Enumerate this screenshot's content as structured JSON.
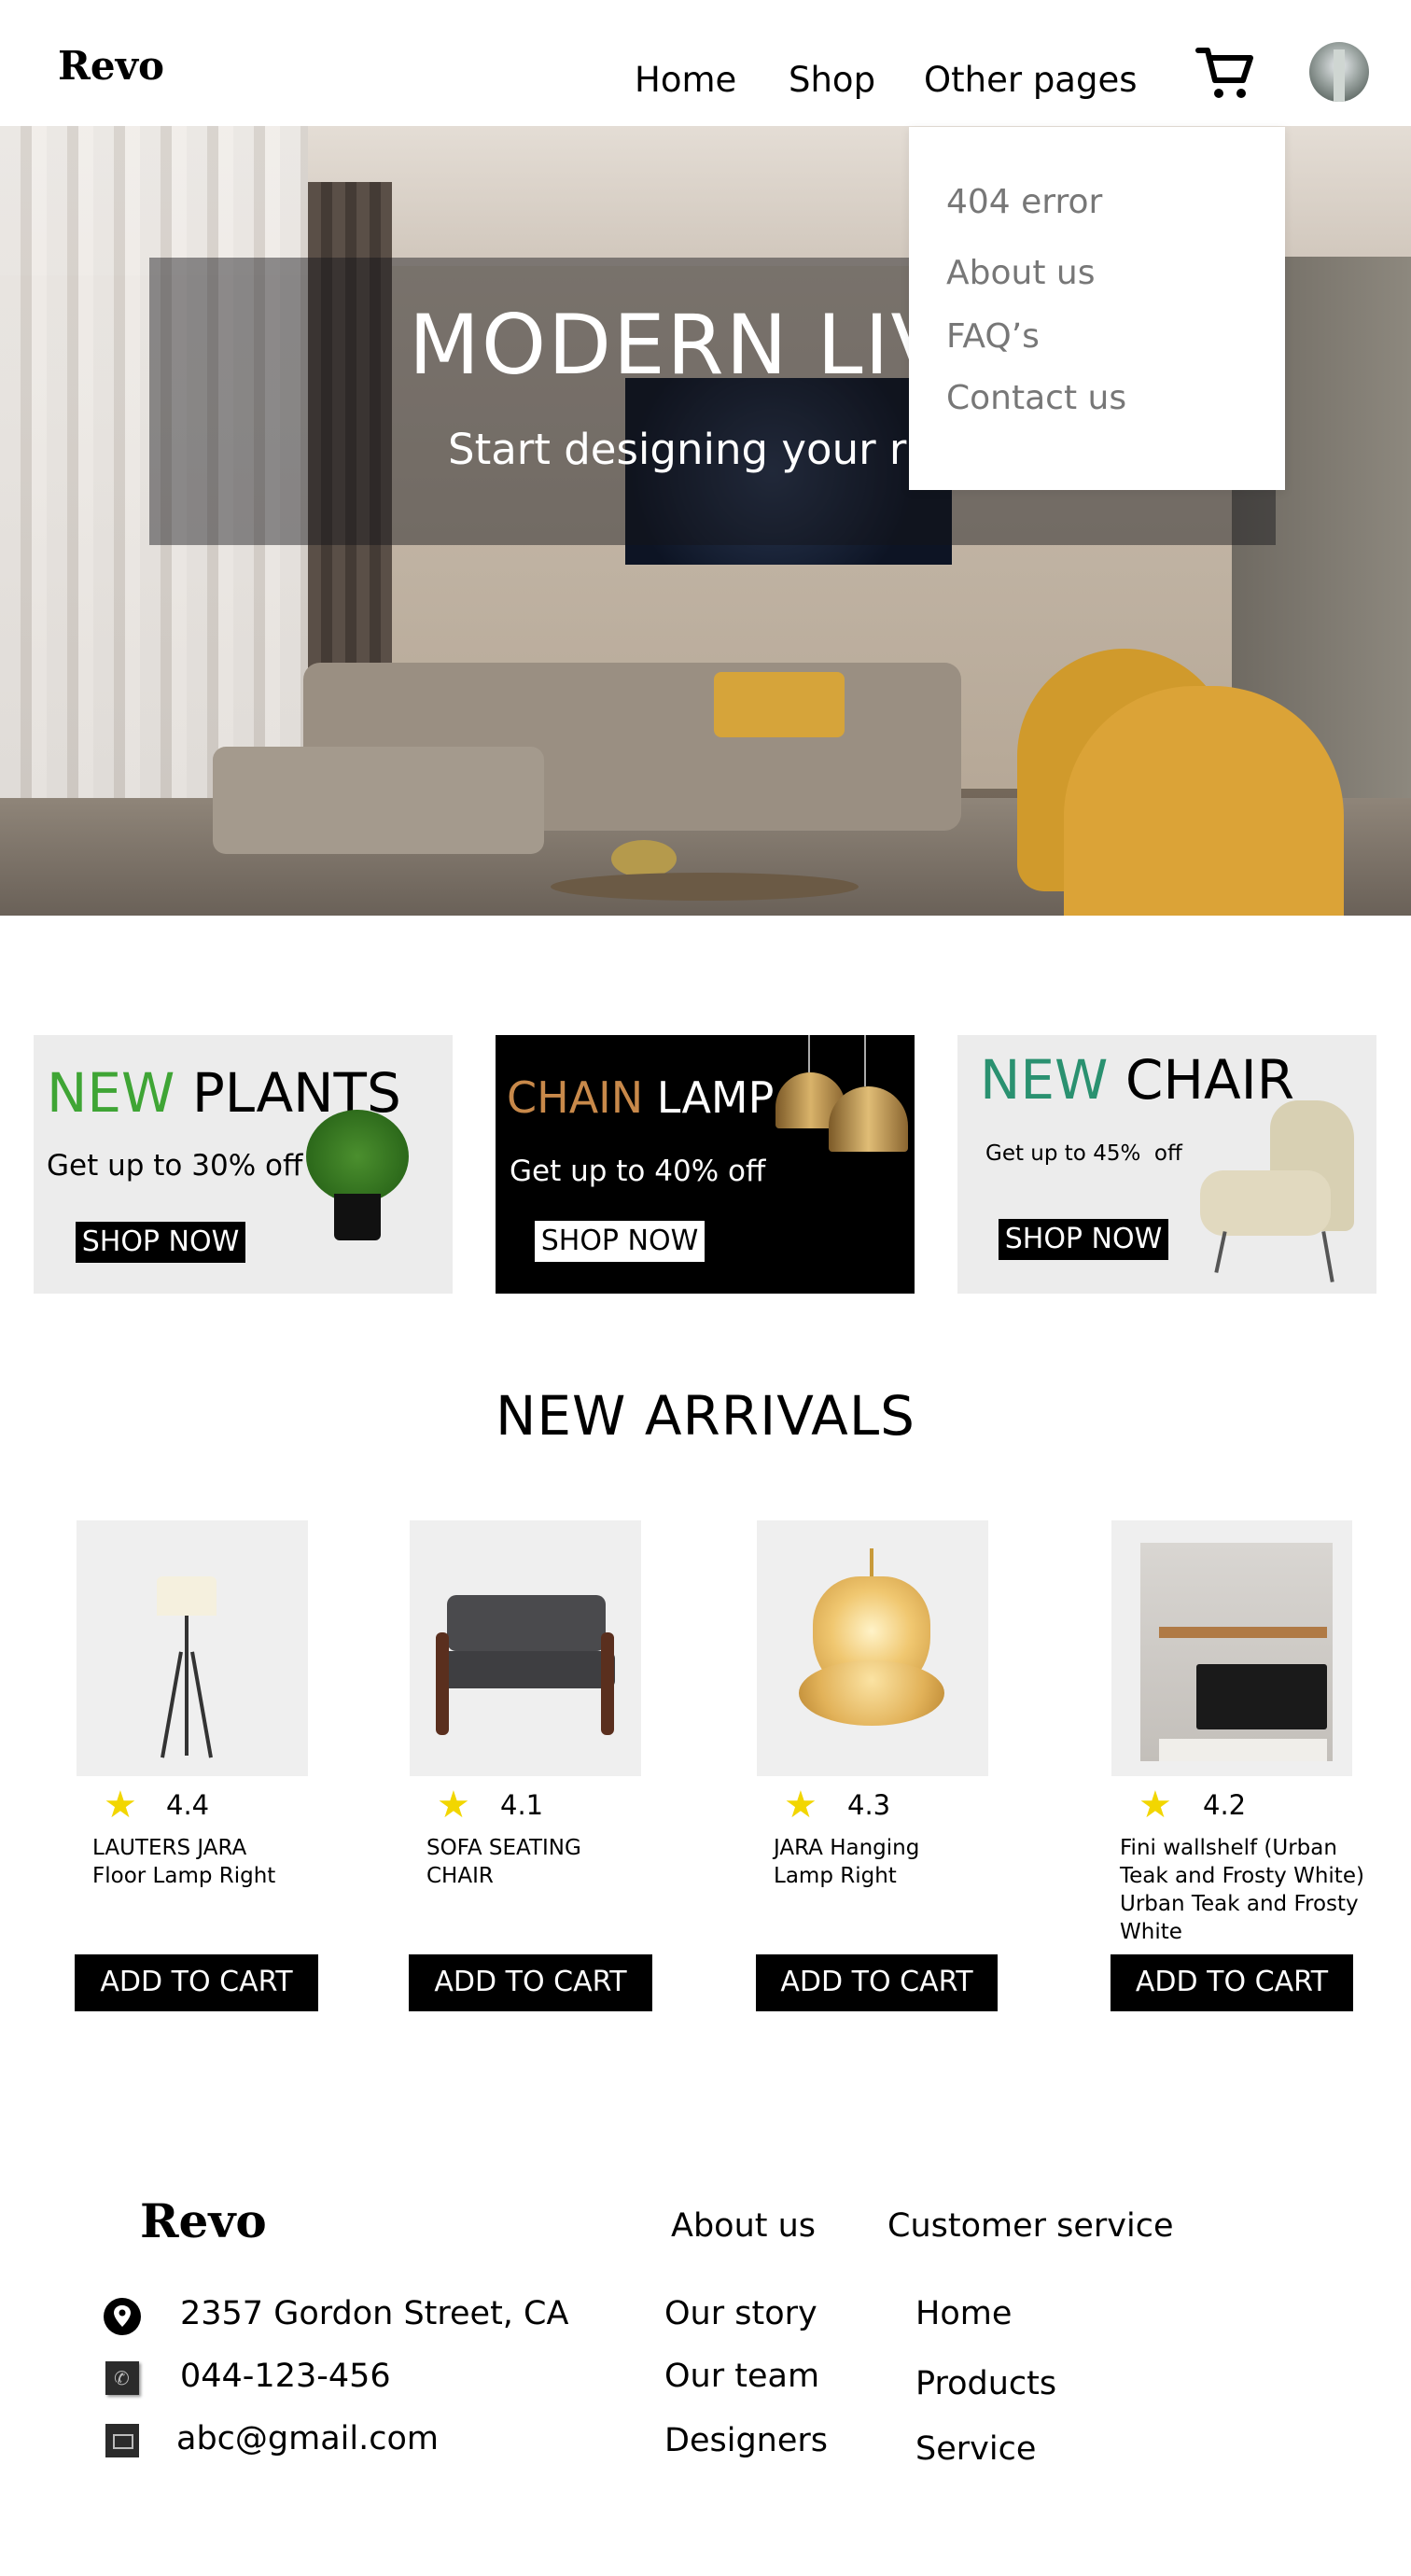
{
  "header": {
    "logo": "Revo",
    "nav": [
      "Home",
      "Shop",
      "Other pages"
    ],
    "dropdown": [
      "404 error",
      "About us",
      "FAQ’s",
      "Contact us"
    ]
  },
  "hero": {
    "title": "MODERN LIV",
    "subtitle": "Start designing your r"
  },
  "promos": [
    {
      "accent": "NEW",
      "title": " PLANTS",
      "text": "Get up to 30% off",
      "button": "SHOP NOW"
    },
    {
      "accent": "CHAIN",
      "title": " LAMP",
      "text": "Get up to 40% off",
      "button": "SHOP NOW"
    },
    {
      "accent": "NEW",
      "title": " CHAIR",
      "text": "Get up to 45%  off",
      "button": "SHOP NOW"
    }
  ],
  "arrivals": {
    "heading": "NEW ARRIVALS",
    "products": [
      {
        "rating": "4.4",
        "name": "LAUTERS JARA\nFloor Lamp Right",
        "button": "ADD TO CART"
      },
      {
        "rating": "4.1",
        "name": "SOFA SEATING\nCHAIR",
        "button": "ADD TO CART"
      },
      {
        "rating": "4.3",
        "name": "JARA Hanging\nLamp Right",
        "button": "ADD TO CART"
      },
      {
        "rating": "4.2",
        "name": "Fini wallshelf (Urban\nTeak and Frosty White)\nUrban Teak and Frosty\nWhite",
        "button": "ADD TO CART"
      }
    ]
  },
  "footer": {
    "logo": "Revo",
    "address": "2357 Gordon Street, CA",
    "phone": "044-123-456",
    "email": "abc@gmail.com",
    "col1_title": "About us",
    "col1": [
      "Our story",
      "Our team",
      "Designers"
    ],
    "col2_title": "Customer service",
    "col2": [
      "Home",
      "Products",
      "Service"
    ]
  },
  "colors": {
    "plants_accent": "#3fa535",
    "lamp_accent": "#c8894a",
    "chair_accent": "#2a9170",
    "star": "#f2d600"
  }
}
